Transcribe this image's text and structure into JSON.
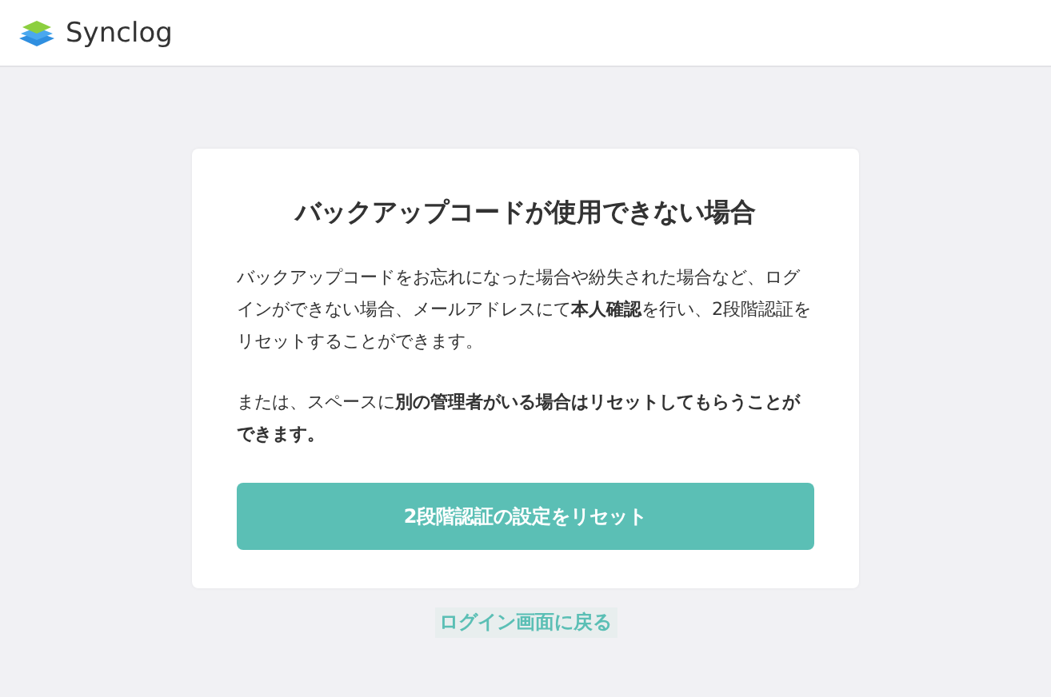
{
  "header": {
    "logo_text": "Synclog"
  },
  "card": {
    "title": "バックアップコードが使用できない場合",
    "paragraphs": [
      "バックアップコードをお忘れになった場合や紛失された場合など、ログインができない場合、メールアドレスにて**本人確認**を行い、2段階認証をリセットすることができます。",
      "または、スペースに**別の管理者がいる場合はリセットしてもらうことができます。**"
    ],
    "button": "2段階認証の設定をリセット"
  },
  "back_link": "ログイン画面に戻る"
}
